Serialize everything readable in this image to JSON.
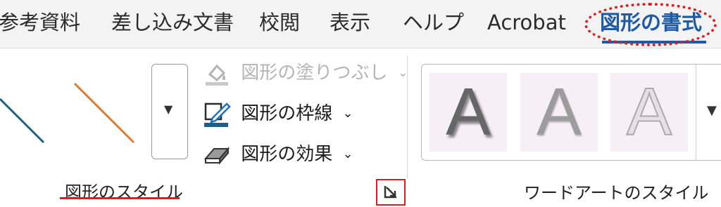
{
  "tabs": [
    {
      "label": "参考資料"
    },
    {
      "label": "差し込み文書"
    },
    {
      "label": "校閲"
    },
    {
      "label": "表示"
    },
    {
      "label": "ヘルプ"
    },
    {
      "label": "Acrobat"
    },
    {
      "label": "図形の書式",
      "active": true
    }
  ],
  "shape_styles_group": {
    "label": "図形のスタイル",
    "commands": {
      "fill": {
        "label": "図形の塗りつぶし",
        "disabled": true
      },
      "outline": {
        "label": "図形の枠線"
      },
      "effects": {
        "label": "図形の効果"
      }
    },
    "gallery_line_colors": [
      "#1f5f86",
      "#e07a30"
    ]
  },
  "wordart_group": {
    "label": "ワードアートのスタイル",
    "samples": [
      {
        "text": "A",
        "style": "shadow"
      },
      {
        "text": "A",
        "style": "gradient"
      },
      {
        "text": "A",
        "style": "outline"
      }
    ]
  },
  "colors": {
    "accent": "#1f5aa6",
    "highlight_red": "#e01e1e",
    "outline_swatch": "#1f5f86"
  }
}
